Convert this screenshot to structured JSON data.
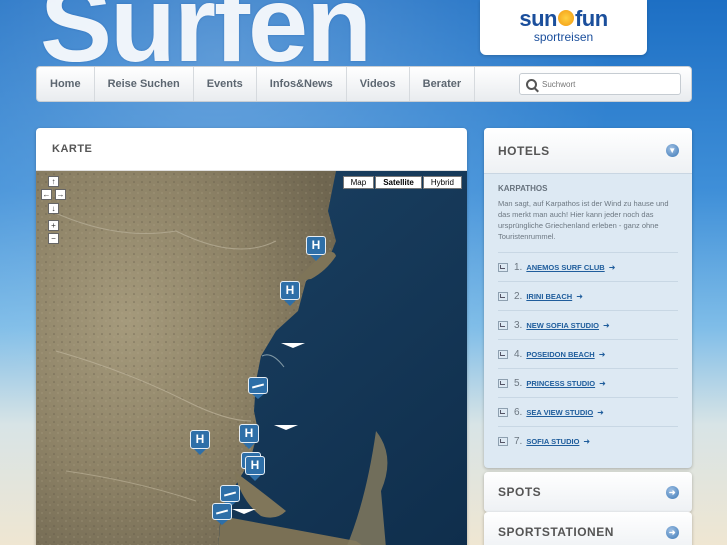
{
  "header": {
    "banner_title": "Surfen",
    "logo_brand_left": "sun",
    "logo_brand_right": "fun",
    "logo_sub": "sportreisen"
  },
  "nav": {
    "items": [
      "Home",
      "Reise Suchen",
      "Events",
      "Infos&News",
      "Videos",
      "Berater"
    ],
    "search_placeholder": "Suchwort"
  },
  "map_panel": {
    "title": "KARTE",
    "map_types": [
      "Map",
      "Satellite",
      "Hybrid"
    ],
    "active_map_type": "Satellite",
    "marker_label": "H"
  },
  "hotels": {
    "title": "HOTELS",
    "region": "KARPATHOS",
    "description": "Man sagt, auf Karpathos ist der Wind zu hause und das merkt man auch! Hier kann jeder noch das ursprüngliche Griechenland erleben - ganz ohne Touristenrummel.",
    "items": [
      {
        "num": "1.",
        "name": "ANEMOS SURF CLUB"
      },
      {
        "num": "2.",
        "name": "IRINI BEACH"
      },
      {
        "num": "3.",
        "name": "NEW SOFIA STUDIO"
      },
      {
        "num": "4.",
        "name": "POSEIDON BEACH"
      },
      {
        "num": "5.",
        "name": "PRINCESS STUDIO"
      },
      {
        "num": "6.",
        "name": "SEA VIEW STUDIO"
      },
      {
        "num": "7.",
        "name": "SOFIA STUDIO"
      }
    ]
  },
  "spots": {
    "title": "SPOTS"
  },
  "stations": {
    "title": "SPORTSTATIONEN"
  },
  "colors": {
    "accent": "#1f5d9c",
    "marker": "#2e6fa8"
  }
}
